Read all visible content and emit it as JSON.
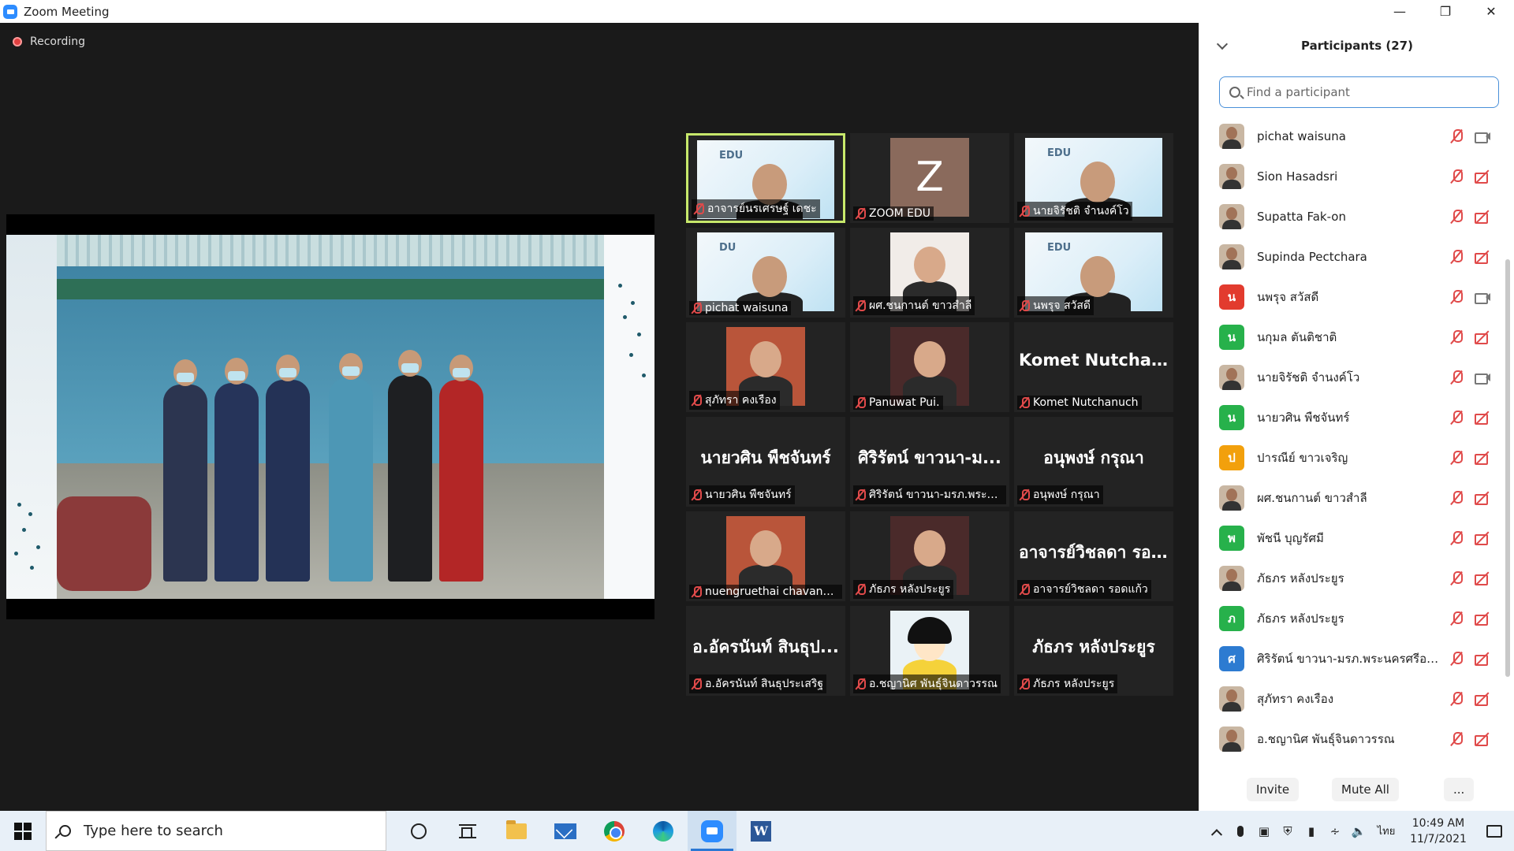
{
  "window": {
    "title": "Zoom Meeting"
  },
  "meeting": {
    "recording_label": "Recording",
    "tiles": [
      {
        "name": "อาจารย์นรเศรษฐ์ เดชะ",
        "type": "edu-video",
        "active": true,
        "logo": "EDU"
      },
      {
        "name": "ZOOM EDU",
        "type": "avatar-z",
        "letter": "Z"
      },
      {
        "name": "นายจิรัชติ จำนงค์โว",
        "type": "edu-video",
        "logo": "EDU"
      },
      {
        "name": "pichat waisuna",
        "type": "edu-video",
        "logo": "DU"
      },
      {
        "name": "ผศ.ชนกานต์ ขาวสำลี",
        "type": "video"
      },
      {
        "name": "นพรุจ สวัสดี",
        "type": "edu-video",
        "logo": "EDU"
      },
      {
        "name": "สุภัทรา คงเรือง",
        "type": "video"
      },
      {
        "name": "Panuwat Pui.",
        "type": "video"
      },
      {
        "name": "Komet Nutchanuch",
        "type": "name-only",
        "big": "Komet Nutchan..."
      },
      {
        "name": "นายวศิน พืชจันทร์",
        "type": "name-only",
        "big": "นายวศิน พืชจันทร์"
      },
      {
        "name": "ศิริรัตน์ ขาวนา-มรภ.พระน...",
        "type": "name-only",
        "big": "ศิริรัตน์ ขาวนา-ม..."
      },
      {
        "name": "อนุพงษ์ กรุณา",
        "type": "name-only",
        "big": "อนุพงษ์ กรุณา"
      },
      {
        "name": "nuengruethai chavanal...",
        "type": "video"
      },
      {
        "name": "ภัธภร หลังประยูร",
        "type": "video"
      },
      {
        "name": "อาจารย์วิชลดา รอดแก้ว",
        "type": "name-only",
        "big": "อาจารย์วิชลดา รอ..."
      },
      {
        "name": "อ.อัครนันท์ สินธุประเสริฐ",
        "type": "name-only",
        "big": "อ.อัครนันท์ สินธุป..."
      },
      {
        "name": "อ.ชญานิศ พันธุ์จินดาวรรณ",
        "type": "cartoon"
      },
      {
        "name": "ภัธภร หลังประยูร",
        "type": "name-only",
        "big": "ภัธภร หลังประยูร"
      }
    ]
  },
  "participants": {
    "title": "Participants (27)",
    "search_placeholder": "Find a participant",
    "list": [
      {
        "name": "pichat waisuna",
        "avatar": "photo",
        "cam": "on"
      },
      {
        "name": "Sion Hasadsri",
        "avatar": "photo",
        "cam": "off"
      },
      {
        "name": "Supatta Fak-on",
        "avatar": "photo",
        "cam": "off"
      },
      {
        "name": "Supinda Pectchara",
        "avatar": "photo",
        "cam": "off"
      },
      {
        "name": "นพรุจ สวัสดี",
        "avatar": "letter",
        "letter": "น",
        "color": "#e23b2e",
        "cam": "on"
      },
      {
        "name": "นกุมล ตันติชาติ",
        "avatar": "letter",
        "letter": "น",
        "color": "#27b14b",
        "cam": "off"
      },
      {
        "name": "นายจิรัชติ จำนงค์โว",
        "avatar": "photo",
        "cam": "on"
      },
      {
        "name": "นายวศิน พืชจันทร์",
        "avatar": "letter",
        "letter": "น",
        "color": "#27b14b",
        "cam": "off"
      },
      {
        "name": "ปารณีย์ ขาวเจริญ",
        "avatar": "letter",
        "letter": "ป",
        "color": "#f2a00c",
        "cam": "off"
      },
      {
        "name": "ผศ.ชนกานต์ ขาวสำลี",
        "avatar": "photo",
        "cam": "off"
      },
      {
        "name": "พัชนี บุญรัศมี",
        "avatar": "letter",
        "letter": "พ",
        "color": "#27b14b",
        "cam": "off"
      },
      {
        "name": "ภัธภร หลังประยูร",
        "avatar": "photo",
        "cam": "off"
      },
      {
        "name": "ภัธภร หลังประยูร",
        "avatar": "letter",
        "letter": "ภ",
        "color": "#27b14b",
        "cam": "off"
      },
      {
        "name": "ศิริรัตน์ ขาวนา-มรภ.พระนครศรีอยุธยา",
        "avatar": "letter",
        "letter": "ศ",
        "color": "#2d7bd1",
        "cam": "off"
      },
      {
        "name": "สุภัทรา คงเรือง",
        "avatar": "photo",
        "cam": "off"
      },
      {
        "name": "อ.ชญานิศ พันธุ์จินดาวรรณ",
        "avatar": "photo",
        "cam": "off"
      }
    ],
    "invite_label": "Invite",
    "mute_all_label": "Mute All",
    "more_label": "..."
  },
  "taskbar": {
    "search_text": "Type here to search",
    "lang": "ไทย",
    "time": "10:49 AM",
    "date": "11/7/2021"
  }
}
